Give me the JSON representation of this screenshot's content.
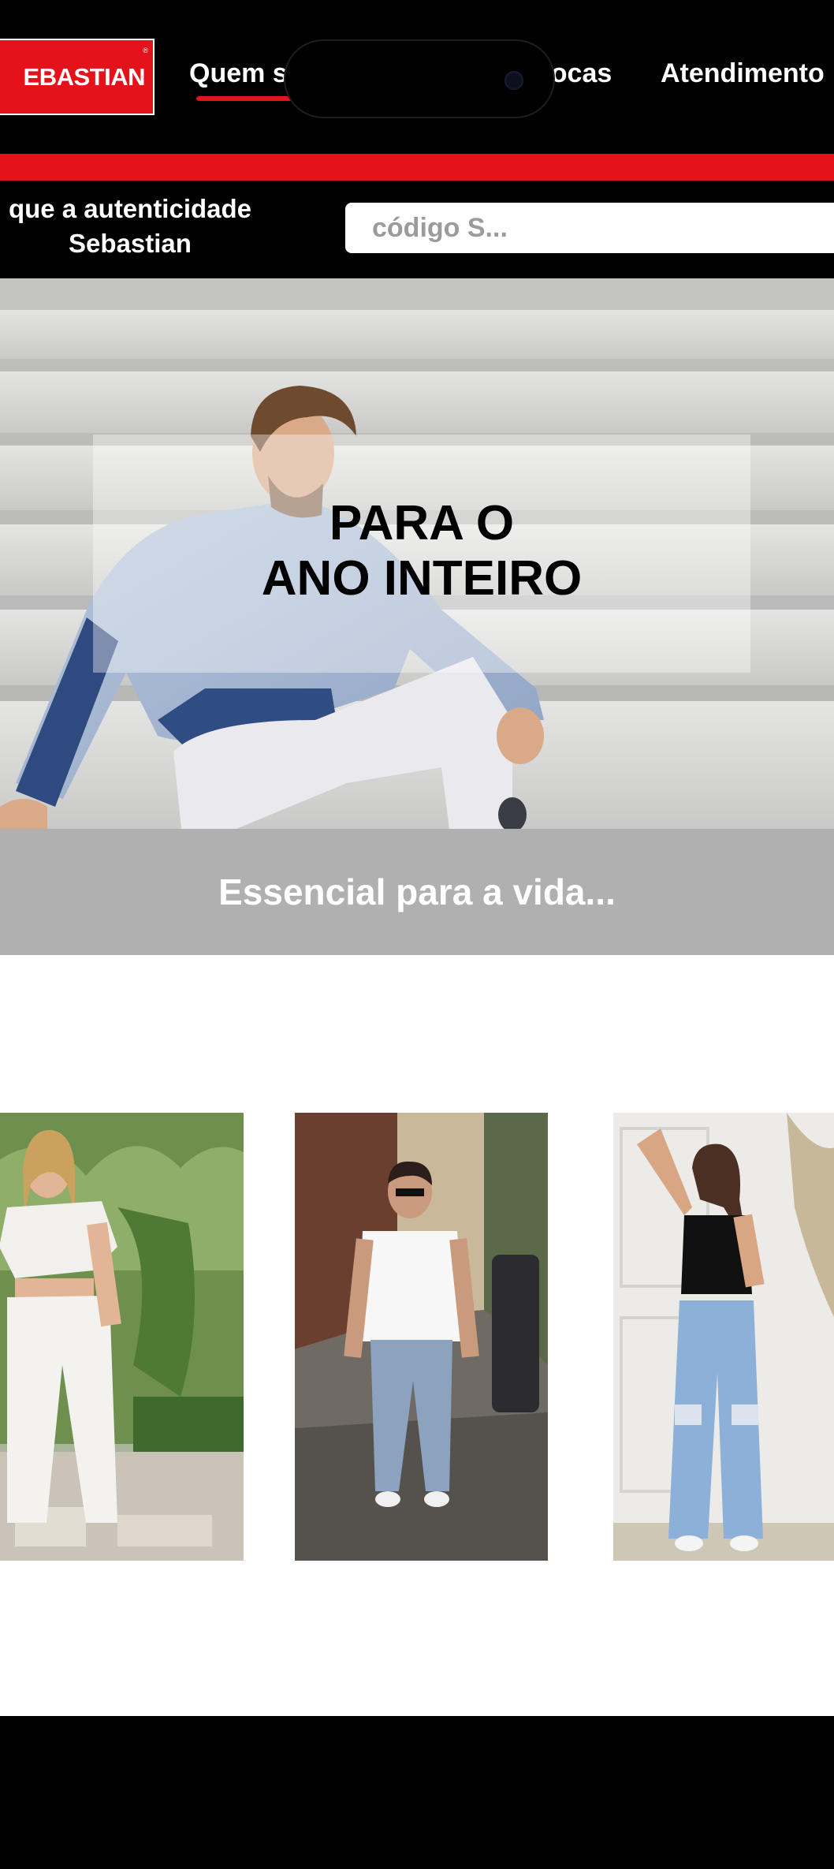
{
  "header": {
    "logo_text": "EBASTIAN",
    "logo_mark": "®",
    "nav": [
      {
        "label": "Quem s"
      },
      {
        "label": "pocas"
      },
      {
        "label": "Atendimento"
      }
    ]
  },
  "auth": {
    "text": "que a autenticidade Sebastian",
    "search_placeholder": "código S..."
  },
  "hero": {
    "line1": "PARA O",
    "line2": "ANO INTEIRO"
  },
  "tagline": "Essencial para a vida...",
  "colors": {
    "brand_red": "#e3121b",
    "band_grey": "#b0b0b0",
    "background": "#000000"
  },
  "products": [
    {
      "name": "product-card-white-outfit"
    },
    {
      "name": "product-card-mens-tee-jeans"
    },
    {
      "name": "product-card-ripped-jeans"
    }
  ]
}
